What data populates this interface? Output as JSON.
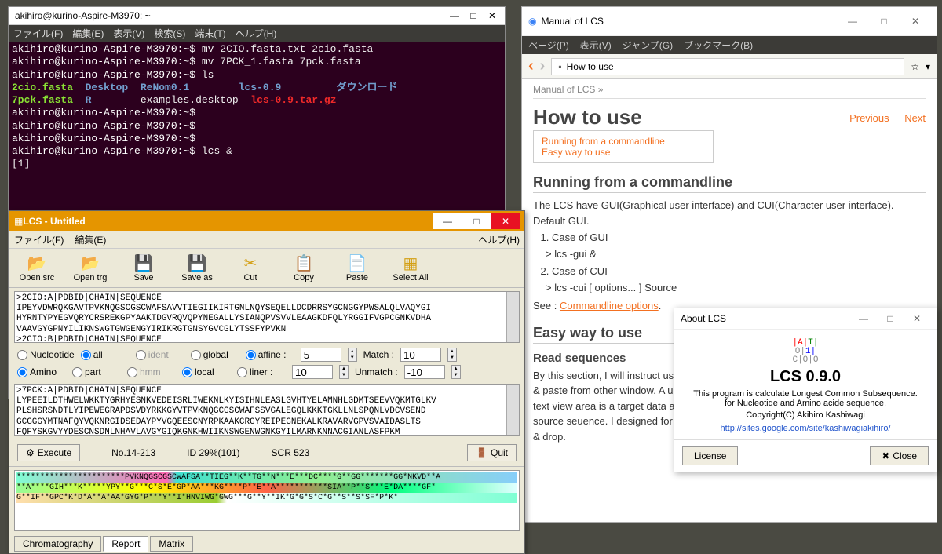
{
  "terminal": {
    "title": "akihiro@kurino-Aspire-M3970: ~",
    "menus": [
      "ファイル(F)",
      "編集(E)",
      "表示(V)",
      "検索(S)",
      "端末(T)",
      "ヘルプ(H)"
    ],
    "prompt": "akihiro@kurino-Aspire-M3970:~$",
    "lines": {
      "l1_cmd": "mv 2CIO.fasta.txt 2cio.fasta",
      "l2_cmd": "mv 7PCK_1.fasta 7pck.fasta",
      "l3_cmd": "ls",
      "ls_out": {
        "c1a": "2cio.fasta",
        "c2a": "Desktop",
        "c3a": "ReNom0.1",
        "c4a": "lcs-0.9",
        "c5a": "ダウンロード",
        "c1b": "7pck.fasta",
        "c2b": "R",
        "c3b": "examples.desktop",
        "c4b": "lcs-0.9.tar.gz"
      },
      "l8_cmd": "lcs &",
      "l9": "[1]"
    }
  },
  "lcs": {
    "title": "LCS - Untitled",
    "menus_left": [
      "ファイル(F)",
      "編集(E)"
    ],
    "menu_right": "ヘルプ(H)",
    "toolbar": [
      "Open src",
      "Open trg",
      "Save",
      "Save as",
      "Cut",
      "Copy",
      "Paste",
      "Select All"
    ],
    "seq1": ">2CIO:A|PDBID|CHAIN|SEQUENCE\nIPEYVDWRQKGAVTPVKNQGSCGSCWAFSAVVTIEGIIKIRTGNLNQYSEQELLDCDRRSYGCNGGYPWSALQLVAQYGI\nHYRNTYPYEGVQRYCRSREKGPYAAKTDGVRQVQPYNEGALLYSIANQPVSVVLEAAGKDFQLYRGGIFVGPCGNKVDHA\nVAAVGYGPNYILIKNSWGTGWGENGYIRIKRGTGNSYGVCGLYTSSFYPVKN\n>2CIO:B|PDBID|CHAIN|SEQUENCE",
    "seq2": ">7PCK:A|PDBID|CHAIN|SEQUENCE\nLYPEEILDTHWELWKKTYGRHYESNKVEDEISRLIWEKNLKYISIHNLEASLGVHTYELAMNHLGDMTSEEVVQKMTGLKV\nPLSHSRSNDTLYIPEWEGRAPDSVDYRKKGYVTPVKNQGCGSCWAFSSVGALEGQLKKKTGKLLNLSPQNLVDCVSEND\nGCGGGYMTNAFQYVQKNRGIDSEDAYPYVGQEESCNYRPKAAKCRGYREIPEGNEKALKRAVARVGPVSVAIDASLTS\nFQFYSKGVYYDESCNSDNLNHAVLAVGYGIQKGNKHWIIKNSWGENWGNKGYILMARNKNNACGIANLASFPKM",
    "opts": {
      "mode_a": "Nucleotide",
      "mode_b": "Amino",
      "scope_a": "all",
      "scope_b": "part",
      "align_a": "ident",
      "align_b": "hmm",
      "meth_a": "global",
      "meth_b": "local",
      "score_a": "affine :",
      "score_b": "liner :",
      "val1": "5",
      "val2": "10",
      "match_l": "Match :",
      "match_v": "10",
      "unmatch_l": "Unmatch :",
      "unmatch_v": "-10"
    },
    "exec": {
      "btn": "Execute",
      "no": "No.14-213",
      "id": "ID 29%(101)",
      "scr": "SCR 523",
      "quit": "Quit"
    },
    "align_r1": "***********************PVKNQGSCGSCWAFSA**TIEG**K**TG**N***E***DC****G**GG*******GG*NKVD**A",
    "align_r2": "**A****GIH***K*****YPY**G***C*S*E*GP*AA***KG****P**E**A***********SIA**P**S***E*DA****GF*",
    "align_r3": "G**IF**GPC*K*D*A**A*AA*GYG*P***Y**I*HNVIWG*GWG***G**Y**IK*G*G*S*C*G**S**S*SF*P*K*",
    "tabs": [
      "Chromatography",
      "Report",
      "Matrix"
    ]
  },
  "manual": {
    "title": "Manual of LCS",
    "menus": [
      "ページ(P)",
      "表示(V)",
      "ジャンプ(G)",
      "ブックマーク(B)"
    ],
    "url_text": "How to use",
    "crumb": "Manual of LCS »",
    "h1": "How to use",
    "prev": "Previous",
    "next": "Next",
    "toc1": "Running from a commandline",
    "toc2": "Easy way to use",
    "h2a": "Running from a commandline",
    "p1": "The LCS have GUI(Graphical user interface) and CUI(Character user interface). Default GUI.",
    "li1": "Case of GUI",
    "cmd1": "> lcs -gui &",
    "li2": "Case of CUI",
    "cmd2": "> lcs -cui [ options... ] Source",
    "see": "See : ",
    "see_link": "Commandline options",
    "h2b": "Easy way to use",
    "h3a": "Read sequences",
    "p2": "By this section, I will instruct user interface of a standard GUI sequence file. And copy & paste from other window. A upper text view area is a source data area, and a lower text view area is a target data area. A source data mean find a target sequence in a source seuence. I designed for copy & paste. But you can use menu, toolbar and drag & drop."
  },
  "about": {
    "title": "About LCS",
    "name": "LCS 0.9.0",
    "desc1": "This program is calculate Longest Common Subsequence.",
    "desc2": "for Nucleotide and Amino acide sequence.",
    "copy": "Copyright(C) Akihiro Kashiwagi",
    "url": "http://sites.google.com/site/kashiwagiakihiro/",
    "license": "License",
    "close": "Close"
  }
}
